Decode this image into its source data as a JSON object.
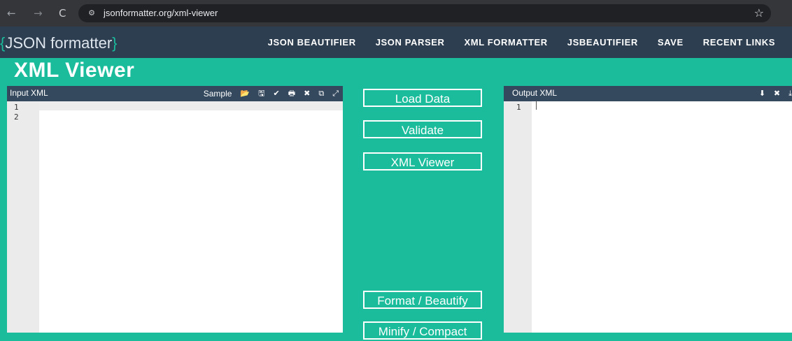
{
  "browser": {
    "back_icon": "←",
    "forward_icon": "→",
    "reload_icon": "C",
    "site_info_icon": "⚙",
    "url": "jsonformatter.org/xml-viewer",
    "star_icon": "☆"
  },
  "header": {
    "logo_open": "{",
    "logo_text": "JSON formatter",
    "logo_close": "}",
    "nav": [
      "JSON BEAUTIFIER",
      "JSON PARSER",
      "XML FORMATTER",
      "JSBEAUTIFIER",
      "SAVE",
      "RECENT LINKS"
    ]
  },
  "page_title": "XML Viewer",
  "input_panel": {
    "title": "Input XML",
    "sample_label": "Sample",
    "icons": [
      "📂",
      "🖫",
      "✔",
      "🖶",
      "✖",
      "⧉",
      "⤢"
    ],
    "line_numbers": [
      "1",
      "2"
    ]
  },
  "output_panel": {
    "title": "Output XML",
    "icons": [
      "⬇",
      "✖",
      "⤓"
    ],
    "line_numbers": [
      "1"
    ]
  },
  "actions": {
    "load_data": "Load Data",
    "validate": "Validate",
    "xml_viewer": "XML Viewer",
    "format_beautify": "Format / Beautify",
    "minify_compact": "Minify / Compact"
  },
  "colors": {
    "accent": "#1abc9c",
    "header_bg": "#2c3e50",
    "panel_head_bg": "#34495e"
  }
}
